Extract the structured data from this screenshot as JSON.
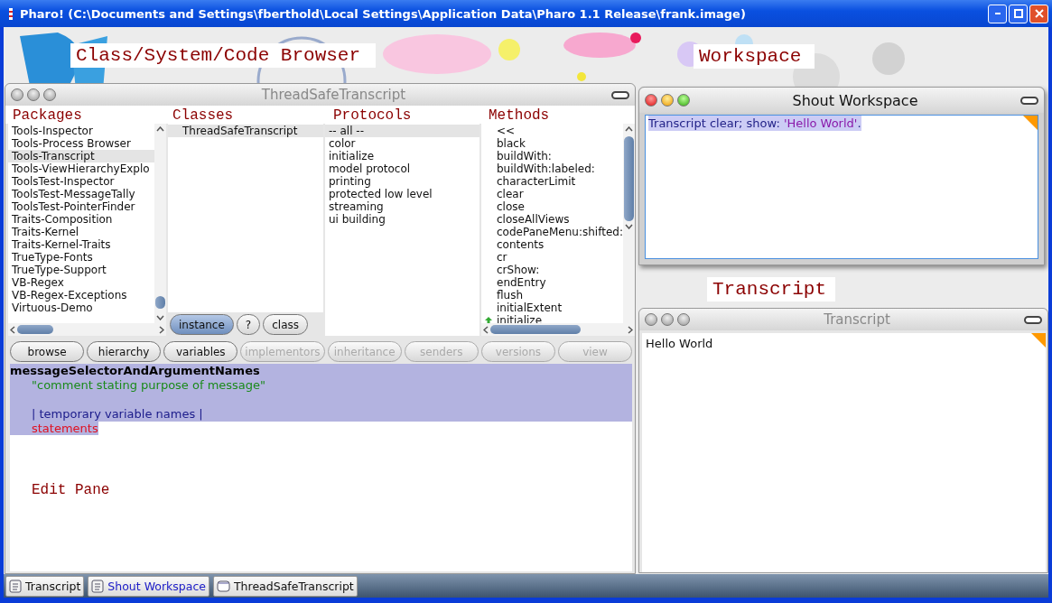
{
  "window": {
    "title": "Pharo! (C:\\Documents and Settings\\fberthold\\Local Settings\\Application Data\\Pharo 1.1 Release\\frank.image)"
  },
  "annotations": {
    "browser": "Class/System/Code Browser",
    "workspace": "Workspace",
    "transcript": "Transcript",
    "edit_pane": "Edit Pane"
  },
  "browser": {
    "title": "ThreadSafeTranscript",
    "active": false,
    "panes": [
      {
        "heading": "Packages",
        "items": [
          {
            "label": "Tools-Inspector",
            "selected": false
          },
          {
            "label": "Tools-Process Browser",
            "selected": false
          },
          {
            "label": "Tools-Transcript",
            "selected": true
          },
          {
            "label": "Tools-ViewHierarchyExplo",
            "selected": false
          },
          {
            "label": "ToolsTest-Inspector",
            "selected": false
          },
          {
            "label": "ToolsTest-MessageTally",
            "selected": false
          },
          {
            "label": "ToolsTest-PointerFinder",
            "selected": false
          },
          {
            "label": "Traits-Composition",
            "selected": false
          },
          {
            "label": "Traits-Kernel",
            "selected": false
          },
          {
            "label": "Traits-Kernel-Traits",
            "selected": false
          },
          {
            "label": "TrueType-Fonts",
            "selected": false
          },
          {
            "label": "TrueType-Support",
            "selected": false
          },
          {
            "label": "VB-Regex",
            "selected": false
          },
          {
            "label": "VB-Regex-Exceptions",
            "selected": false
          },
          {
            "label": "Virtuous-Demo",
            "selected": false
          }
        ]
      },
      {
        "heading": "Classes",
        "items": [
          {
            "label": "ThreadSafeTranscript",
            "selected": true
          }
        ]
      },
      {
        "heading": "Protocols",
        "items": [
          {
            "label": "-- all --",
            "selected": true
          },
          {
            "label": "color",
            "selected": false
          },
          {
            "label": "initialize",
            "selected": false
          },
          {
            "label": "model protocol",
            "selected": false
          },
          {
            "label": "printing",
            "selected": false
          },
          {
            "label": "protected low level",
            "selected": false
          },
          {
            "label": "streaming",
            "selected": false
          },
          {
            "label": "ui building",
            "selected": false
          }
        ]
      },
      {
        "heading": "Methods",
        "items": [
          {
            "label": "<<",
            "selected": false,
            "override": false
          },
          {
            "label": "black",
            "selected": false,
            "override": false
          },
          {
            "label": "buildWith:",
            "selected": false,
            "override": false
          },
          {
            "label": "buildWith:labeled:",
            "selected": false,
            "override": false
          },
          {
            "label": "characterLimit",
            "selected": false,
            "override": false
          },
          {
            "label": "clear",
            "selected": false,
            "override": false
          },
          {
            "label": "close",
            "selected": false,
            "override": false
          },
          {
            "label": "closeAllViews",
            "selected": false,
            "override": false
          },
          {
            "label": "codePaneMenu:shifted:",
            "selected": false,
            "override": false
          },
          {
            "label": "contents",
            "selected": false,
            "override": false
          },
          {
            "label": "cr",
            "selected": false,
            "override": false
          },
          {
            "label": "crShow:",
            "selected": false,
            "override": false
          },
          {
            "label": "endEntry",
            "selected": false,
            "override": false
          },
          {
            "label": "flush",
            "selected": false,
            "override": false
          },
          {
            "label": "initialExtent",
            "selected": false,
            "override": false
          },
          {
            "label": "initialize",
            "selected": false,
            "override": true
          }
        ]
      }
    ],
    "side_buttons": [
      {
        "label": "instance",
        "selected": true
      },
      {
        "label": "?",
        "selected": false
      },
      {
        "label": "class",
        "selected": false
      }
    ],
    "buttons": [
      {
        "label": "browse",
        "disabled": false
      },
      {
        "label": "hierarchy",
        "disabled": false
      },
      {
        "label": "variables",
        "disabled": false
      },
      {
        "label": "implementors",
        "disabled": true
      },
      {
        "label": "inheritance",
        "disabled": true
      },
      {
        "label": "senders",
        "disabled": true
      },
      {
        "label": "versions",
        "disabled": true
      },
      {
        "label": "view",
        "disabled": true
      }
    ],
    "code": {
      "selected": true,
      "lines": [
        {
          "kind": "selector",
          "text": "messageSelectorAndArgumentNames"
        },
        {
          "kind": "comment",
          "text": "\"comment stating purpose of message\""
        },
        {
          "kind": "blank"
        },
        {
          "kind": "temps",
          "text": "| temporary variable names |"
        },
        {
          "kind": "statements",
          "text": "statements"
        }
      ]
    }
  },
  "workspace": {
    "title": "Shout Workspace",
    "active": true,
    "selected": true,
    "segments": [
      {
        "kind": "code",
        "text": "Transcript clear; show: "
      },
      {
        "kind": "string",
        "text": "'Hello World'"
      },
      {
        "kind": "code",
        "text": "."
      }
    ]
  },
  "transcript": {
    "title": "Transcript",
    "active": false,
    "text": "Hello World"
  },
  "taskbar": [
    {
      "label": "Transcript",
      "kind": "text",
      "selected": false
    },
    {
      "label": "Shout Workspace",
      "kind": "text",
      "selected": true
    },
    {
      "label": "ThreadSafeTranscript",
      "kind": "window",
      "selected": false
    }
  ]
}
